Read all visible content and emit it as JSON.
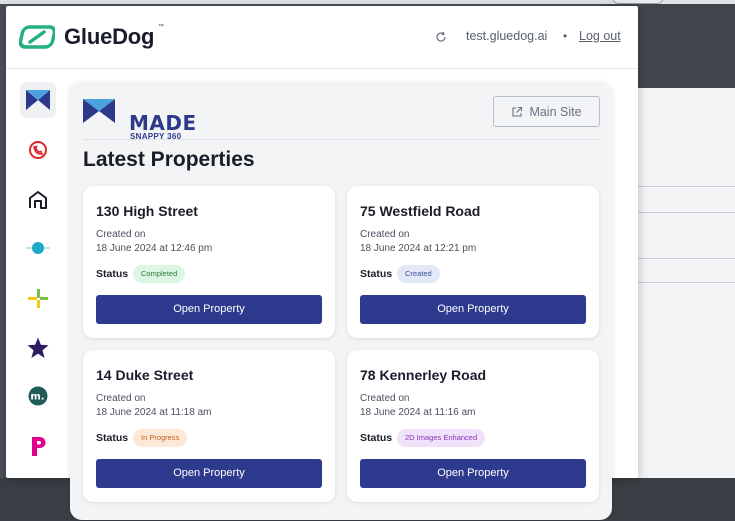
{
  "app": {
    "brand": "GlueDog",
    "trademark": "™",
    "account": "test.gluedog.ai",
    "separator": "•",
    "logout": "Log out"
  },
  "sidebar": {
    "items": [
      {
        "name": "made-snappy-360",
        "icon": "made-logo-icon",
        "color": "#2d3a8c",
        "active": true
      },
      {
        "name": "phone-app",
        "icon": "phone-circle-icon",
        "color": "#e0262b",
        "active": false
      },
      {
        "name": "house-app",
        "icon": "house-outline-icon",
        "color": "#1a1d29",
        "active": false
      },
      {
        "name": "teal-app",
        "icon": "teal-circle-icon",
        "color": "#1fa8c9",
        "active": false
      },
      {
        "name": "plus-app",
        "icon": "green-yellow-plus-icon",
        "color": "#7bc142",
        "active": false
      },
      {
        "name": "star-app",
        "icon": "star-icon",
        "color": "#2c1e5e",
        "active": false
      },
      {
        "name": "m-app",
        "icon": "m-circle-icon",
        "color": "#1f5c57",
        "active": false
      },
      {
        "name": "p-app",
        "icon": "p-letter-icon",
        "color": "#e0008a",
        "active": false
      }
    ]
  },
  "main": {
    "logo_word": "MADE",
    "logo_sub": "SNAPPY 360",
    "main_site_label": "Main Site",
    "section_title": "Latest Properties",
    "properties": [
      {
        "title": "130 High Street",
        "created_label": "Created on",
        "created_date": "18 June 2024 at 12:46 pm",
        "status_label": "Status",
        "status": "Completed",
        "status_bg": "#ddf5e3",
        "status_color": "#2f7a45",
        "action": "Open Property"
      },
      {
        "title": "75 Westfield Road",
        "created_label": "Created on",
        "created_date": "18 June 2024 at 12:21 pm",
        "status_label": "Status",
        "status": "Created",
        "status_bg": "#e2e8f8",
        "status_color": "#3a4fa0",
        "action": "Open Property"
      },
      {
        "title": "14 Duke Street",
        "created_label": "Created on",
        "created_date": "18 June 2024 at 11:18 am",
        "status_label": "Status",
        "status": "In Progress",
        "status_bg": "#fde9d7",
        "status_color": "#c2611d",
        "action": "Open Property"
      },
      {
        "title": "78 Kennerley Road",
        "created_label": "Created on",
        "created_date": "18 June 2024 at 11:16 am",
        "status_label": "Status",
        "status": "2D Images Enhanced",
        "status_bg": "#f1e2fb",
        "status_color": "#8a2fb8",
        "action": "Open Property"
      }
    ]
  },
  "colors": {
    "brand_green": "#22b07d",
    "primary_button": "#2e3a8e"
  }
}
